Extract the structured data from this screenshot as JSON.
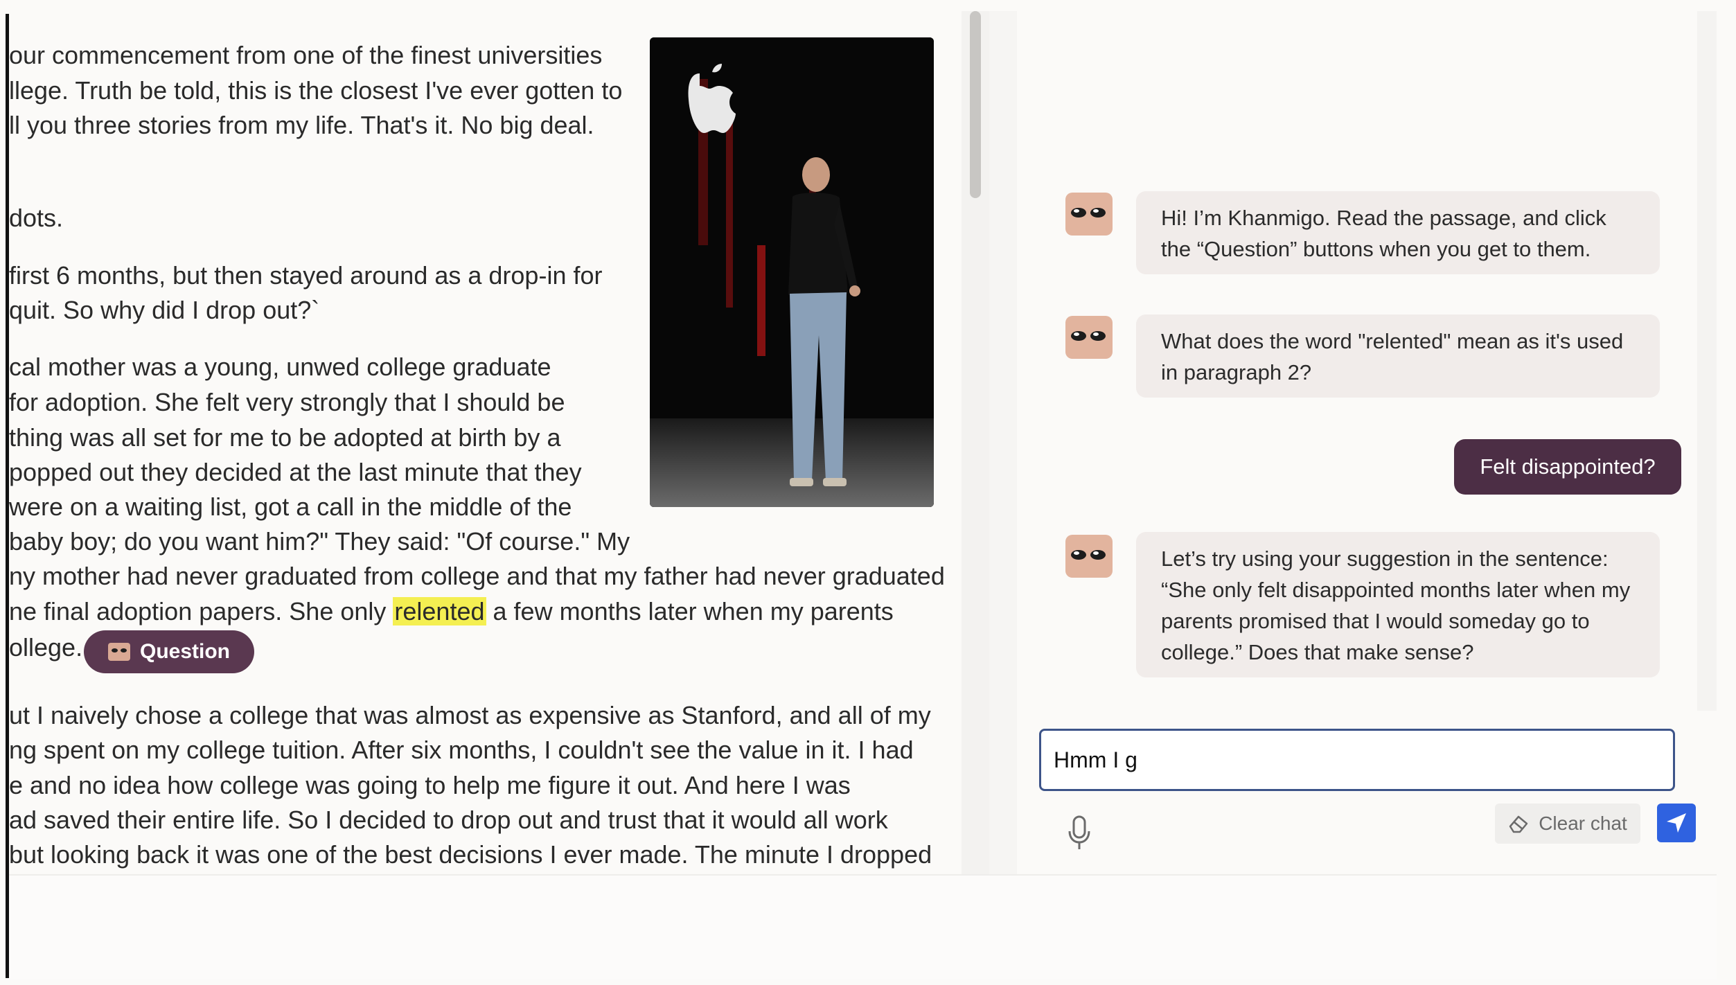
{
  "passage": {
    "lines": [
      "our commencement from one of the finest universities",
      "llege. Truth be told, this is the closest I've ever gotten to",
      "ll you three stories from my life. That's it. No big deal.",
      "dots.",
      " first 6 months, but then stayed around as a drop-in for",
      " quit. So why did I drop out?`",
      "cal mother was a young, unwed college graduate",
      "for adoption. She felt very strongly that I should be",
      "thing was all set for me to be adopted at birth by a",
      " popped out they decided at the last minute that they",
      " were on a waiting list, got a call in the middle of the",
      "baby boy; do you want him?\" They said: \"Of course.\" My",
      "ny mother had never graduated from college and that my father had never graduated",
      "ut I naively chose a college that was almost as expensive as Stanford, and all of my",
      "ng spent on my college tuition. After six months, I couldn't see the value in it. I had",
      "e and no idea how college was going to help me figure it out. And here I was",
      "ad saved their entire life. So I decided to drop out and trust that it would all work",
      "but looking back it was one of the best decisions I ever made. The minute I dropped"
    ],
    "adoption_line_before": "ne final adoption papers. She only ",
    "adoption_line_highlight": "relented",
    "adoption_line_after": " a few months later when my parents",
    "college_line": "ollege.",
    "question_button_label": "Question",
    "highlight_color": "#f4ef52"
  },
  "chat": {
    "messages": [
      {
        "role": "assistant",
        "text": "Hi! I’m Khanmigo. Read the passage, and click the “Question” buttons when you get to them."
      },
      {
        "role": "assistant",
        "text": "What does the word \"relented\" mean as it's used in paragraph 2?"
      },
      {
        "role": "user",
        "text": "Felt disappointed?"
      },
      {
        "role": "assistant",
        "text": "Let’s try using your suggestion in the sentence: “She only felt disappointed months later when my parents promised that I would someday go to college.” Does that make sense?"
      }
    ],
    "input_value": "Hmm I g",
    "clear_chat_label": "Clear chat",
    "user_bubble_color": "#4c2e45",
    "send_button_color": "#2f62e0"
  }
}
